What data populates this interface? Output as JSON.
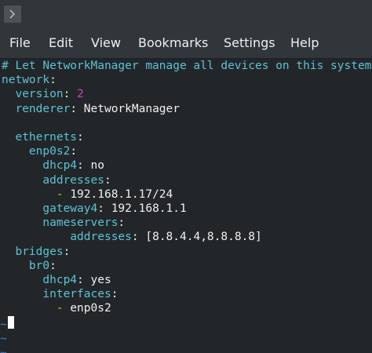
{
  "menu": {
    "items": [
      "File",
      "Edit",
      "View",
      "Bookmarks",
      "Settings",
      "Help"
    ]
  },
  "editor": {
    "comment": "# Let NetworkManager manage all devices on this system",
    "lines": [
      {
        "indent": "",
        "key": "network",
        "sep": ":",
        "value": "",
        "value_type": ""
      },
      {
        "indent": "  ",
        "key": "version",
        "sep": ": ",
        "value": "2",
        "value_type": "num"
      },
      {
        "indent": "  ",
        "key": "renderer",
        "sep": ": ",
        "value": "NetworkManager",
        "value_type": "text"
      },
      {
        "indent": "",
        "key": "",
        "sep": "",
        "value": "",
        "value_type": ""
      },
      {
        "indent": "  ",
        "key": "ethernets",
        "sep": ":",
        "value": "",
        "value_type": ""
      },
      {
        "indent": "    ",
        "key": "enp0s2",
        "sep": ":",
        "value": "",
        "value_type": ""
      },
      {
        "indent": "      ",
        "key": "dhcp4",
        "sep": ": ",
        "value": "no",
        "value_type": "text"
      },
      {
        "indent": "      ",
        "key": "addresses",
        "sep": ":",
        "value": "",
        "value_type": ""
      },
      {
        "indent": "        ",
        "key": "",
        "sep": "",
        "dash": "- ",
        "value": "192.168.1.17/24",
        "value_type": "text"
      },
      {
        "indent": "      ",
        "key": "gateway4",
        "sep": ": ",
        "value": "192.168.1.1",
        "value_type": "text"
      },
      {
        "indent": "      ",
        "key": "nameservers",
        "sep": ":",
        "value": "",
        "value_type": ""
      },
      {
        "indent": "          ",
        "key": "addresses",
        "sep": ": ",
        "value": "[8.8.4.4,8.8.8.8]",
        "value_type": "text"
      },
      {
        "indent": "  ",
        "key": "bridges",
        "sep": ":",
        "value": "",
        "value_type": ""
      },
      {
        "indent": "    ",
        "key": "br0",
        "sep": ":",
        "value": "",
        "value_type": ""
      },
      {
        "indent": "      ",
        "key": "dhcp4",
        "sep": ": ",
        "value": "yes",
        "value_type": "text"
      },
      {
        "indent": "      ",
        "key": "interfaces",
        "sep": ":",
        "value": "",
        "value_type": ""
      },
      {
        "indent": "        ",
        "key": "",
        "sep": "",
        "dash": "- ",
        "value": "enp0s2",
        "value_type": "text"
      }
    ],
    "tildes": [
      "~",
      "~",
      "~"
    ]
  },
  "colors": {
    "key": "#5bc3d6",
    "number": "#c840c8",
    "dash": "#e2b93b",
    "tilde": "#3b7fd6",
    "background": "#232629"
  },
  "icons": {
    "window": "terminal-icon"
  }
}
